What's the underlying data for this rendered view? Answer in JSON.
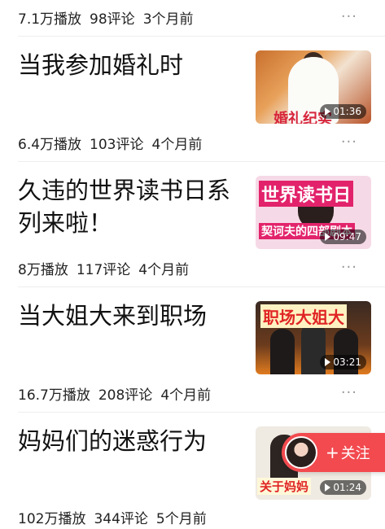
{
  "videos": [
    {
      "plays": "7.1万播放",
      "comments": "98评论",
      "age": "3个月前"
    },
    {
      "title": "当我参加婚礼时",
      "duration": "01:36",
      "thumb_caption": "婚礼纪实",
      "plays": "6.4万播放",
      "comments": "103评论",
      "age": "4个月前"
    },
    {
      "title": "久违的世界读书日系列来啦！",
      "duration": "09:47",
      "thumb_caption": "世界读书日",
      "thumb_caption2": "契诃夫的四部剧本",
      "plays": "8万播放",
      "comments": "117评论",
      "age": "4个月前"
    },
    {
      "title": "当大姐大来到职场",
      "duration": "03:21",
      "thumb_caption": "职场大姐大",
      "plays": "16.7万播放",
      "comments": "208评论",
      "age": "4个月前"
    },
    {
      "title": "妈妈们的迷惑行为",
      "duration": "01:24",
      "thumb_caption": "关于妈妈",
      "plays": "102万播放",
      "comments": "344评论",
      "age": "5个月前"
    }
  ],
  "more_icon": "···",
  "follow": {
    "label": "关注",
    "icon": "plus-icon"
  }
}
